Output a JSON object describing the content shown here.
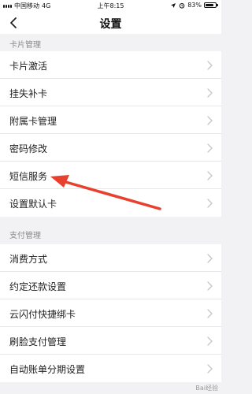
{
  "status_bar": {
    "carrier": "中国移动",
    "network": "4G",
    "time": "上午8:15",
    "battery_percent": "83%",
    "battery_level": 0.83
  },
  "nav": {
    "title": "设置",
    "back_icon": "chevron-left-icon"
  },
  "sections": [
    {
      "header": "卡片管理",
      "items": [
        {
          "label": "卡片激活"
        },
        {
          "label": "挂失补卡"
        },
        {
          "label": "附属卡管理"
        },
        {
          "label": "密码修改"
        },
        {
          "label": "短信服务"
        },
        {
          "label": "设置默认卡"
        }
      ]
    },
    {
      "header": "支付管理",
      "items": [
        {
          "label": "消费方式"
        },
        {
          "label": "约定还款设置"
        },
        {
          "label": "云闪付快捷绑卡"
        },
        {
          "label": "刷脸支付管理"
        },
        {
          "label": "自动账单分期设置"
        }
      ]
    }
  ],
  "colors": {
    "background": "#f2f2f4",
    "annotation_arrow": "#e8402e",
    "chevron": "#c7c7cc"
  },
  "watermark": "Bai经验"
}
